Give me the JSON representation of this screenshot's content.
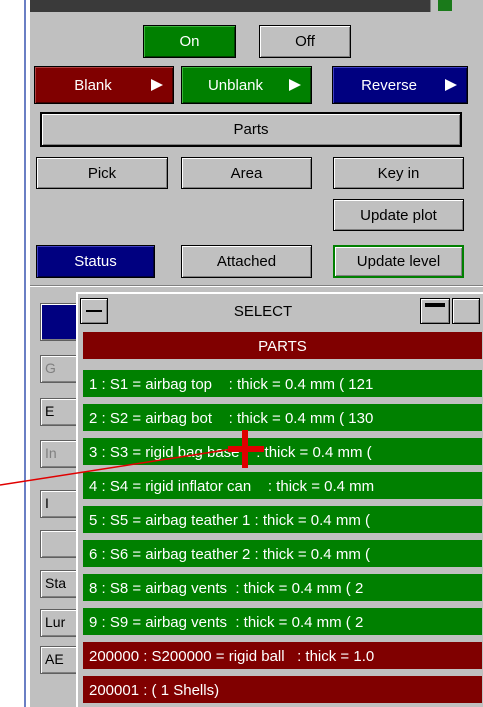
{
  "toggle": {
    "on_label": "On",
    "off_label": "Off"
  },
  "visibility": {
    "blank_label": "Blank",
    "unblank_label": "Unblank",
    "reverse_label": "Reverse"
  },
  "entity_type": {
    "label": "Parts"
  },
  "pick_modes": {
    "pick_label": "Pick",
    "area_label": "Area",
    "keyin_label": "Key in"
  },
  "update_plot_label": "Update plot",
  "footer": {
    "status_label": "Status",
    "attached_label": "Attached",
    "update_level_label": "Update level"
  },
  "underlying_buttons": [
    "G",
    "E",
    "In",
    "I",
    "",
    "Sta",
    "Lur",
    "AE"
  ],
  "select_panel": {
    "title": "SELECT",
    "header": "PARTS",
    "rows": [
      "1 : S1 = airbag top    : thick = 0.4 mm ( 121",
      "2 : S2 = airbag bot    : thick = 0.4 mm ( 130",
      "3 : S3 = rigid bag base    : thick = 0.4 mm (",
      "4 : S4 = rigid inflator can    : thick = 0.4 mm",
      "5 : S5 = airbag teather 1 : thick = 0.4 mm (",
      "6 : S6 = airbag teather 2 : thick = 0.4 mm (",
      "8 : S8 = airbag vents  : thick = 0.4 mm ( 2",
      "9 : S9 = airbag vents  : thick = 0.4 mm ( 2",
      "200000 : S200000 = rigid ball   : thick = 1.0",
      "200001 : ( 1 Shells)"
    ]
  },
  "colors": {
    "green": "#008000",
    "dark_red": "#800000",
    "navy": "#000080",
    "panel_grey": "#c0c0c0",
    "cursor_red": "#e00000"
  }
}
